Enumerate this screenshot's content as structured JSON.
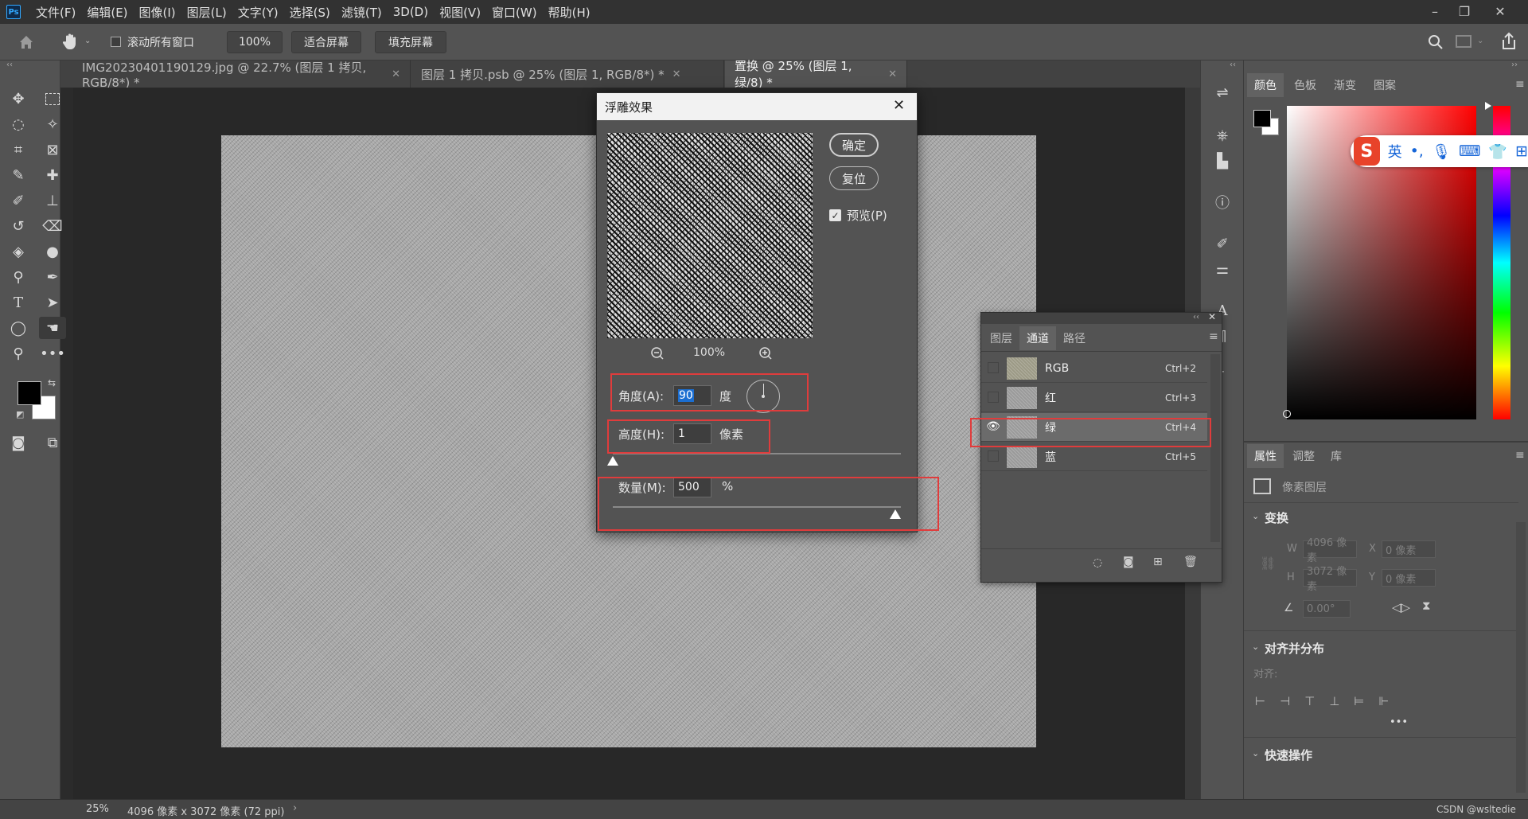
{
  "app": {
    "logo": "Ps",
    "accent": "#31a8ff"
  },
  "menu": [
    "文件(F)",
    "编辑(E)",
    "图像(I)",
    "图层(L)",
    "文字(Y)",
    "选择(S)",
    "滤镜(T)",
    "3D(D)",
    "视图(V)",
    "窗口(W)",
    "帮助(H)"
  ],
  "window_controls": {
    "minimize": "–",
    "restore": "❐",
    "close": "✕"
  },
  "options": {
    "scroll_all_label": "滚动所有窗口",
    "zoom": "100%",
    "fit_screen": "适合屏幕",
    "fill_screen": "填充屏幕"
  },
  "tabs": [
    {
      "label": "IMG20230401190129.jpg @ 22.7% (图层 1 拷贝, RGB/8*) *",
      "active": false
    },
    {
      "label": "图层 1 拷贝.psb @ 25% (图层 1, RGB/8*) *",
      "active": false
    },
    {
      "label": "置换 @ 25% (图层 1, 绿/8) *",
      "active": true
    }
  ],
  "status": {
    "zoom": "25%",
    "doc_size": "4096 像素 x 3072 像素 (72 ppi)",
    "watermark": "CSDN @wsltedie"
  },
  "right_tabs": {
    "color": "颜色",
    "swatches": "色板",
    "gradient": "渐变",
    "patterns": "图案"
  },
  "ime": {
    "lang": "英",
    "punct": "•,"
  },
  "properties": {
    "tabs": [
      "属性",
      "调整",
      "库"
    ],
    "layer_type": "像素图层",
    "transform_title": "变换",
    "w_label": "W",
    "w_value": "4096 像素",
    "h_label": "H",
    "h_value": "3072 像素",
    "x_label": "X",
    "x_value": "0 像素",
    "y_label": "Y",
    "y_value": "0 像素",
    "angle_value": "0.00°",
    "align_title": "对齐并分布",
    "align_label": "对齐:",
    "more": "•••",
    "quick_title": "快速操作"
  },
  "channels": {
    "tabs": [
      "图层",
      "通道",
      "路径"
    ],
    "rows": [
      {
        "name": "RGB",
        "shortcut": "Ctrl+2",
        "visible": false,
        "selected": false
      },
      {
        "name": "红",
        "shortcut": "Ctrl+3",
        "visible": false,
        "selected": false
      },
      {
        "name": "绿",
        "shortcut": "Ctrl+4",
        "visible": true,
        "selected": true
      },
      {
        "name": "蓝",
        "shortcut": "Ctrl+5",
        "visible": false,
        "selected": false
      }
    ]
  },
  "dialog": {
    "title": "浮雕效果",
    "ok": "确定",
    "reset": "复位",
    "preview_label": "预览(P)",
    "preview_checked": true,
    "zoom": "100%",
    "angle_label": "角度(A):",
    "angle_value": "90",
    "angle_unit": "度",
    "height_label": "高度(H):",
    "height_value": "1",
    "height_unit": "像素",
    "amount_label": "数量(M):",
    "amount_value": "500",
    "amount_unit": "%",
    "height_slider_fraction": 0.0,
    "amount_slider_fraction": 1.0
  },
  "highlight_color": "#e03c3c"
}
